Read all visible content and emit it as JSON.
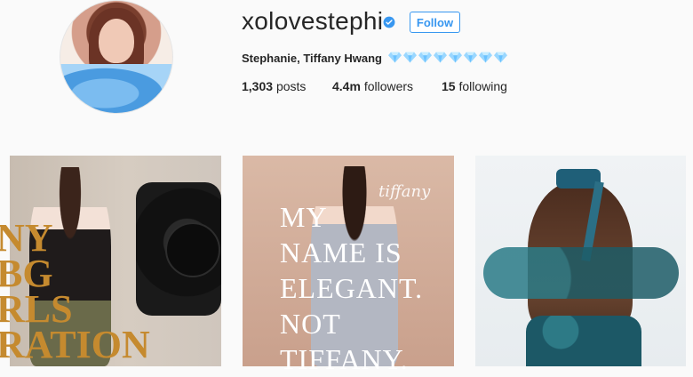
{
  "profile": {
    "username": "xolovestephi",
    "follow_label": "Follow",
    "full_name": "Stephanie, Tiffany Hwang",
    "bio_gem_icons": [
      "gem-icon",
      "gem-icon",
      "gem-icon",
      "gem-icon",
      "gem-icon",
      "gem-icon",
      "gem-icon",
      "gem-icon"
    ],
    "accent_color": "#3897f0",
    "stats": {
      "posts_count": "1,303",
      "posts_label": "posts",
      "followers_count": "4.4m",
      "followers_label": "followers",
      "following_count": "15",
      "following_label": "following"
    }
  },
  "grid": {
    "tiles": [
      {
        "overlay_text_lines": [
          "NY",
          "BG",
          "RLS",
          "RATION"
        ]
      },
      {
        "overlay_text_lines": [
          "MY",
          "NAME IS",
          "ELEGANT.",
          "NOT",
          "TIFFANY."
        ],
        "signature": "tiffany"
      },
      {
        "overlay_text_lines": []
      }
    ]
  }
}
